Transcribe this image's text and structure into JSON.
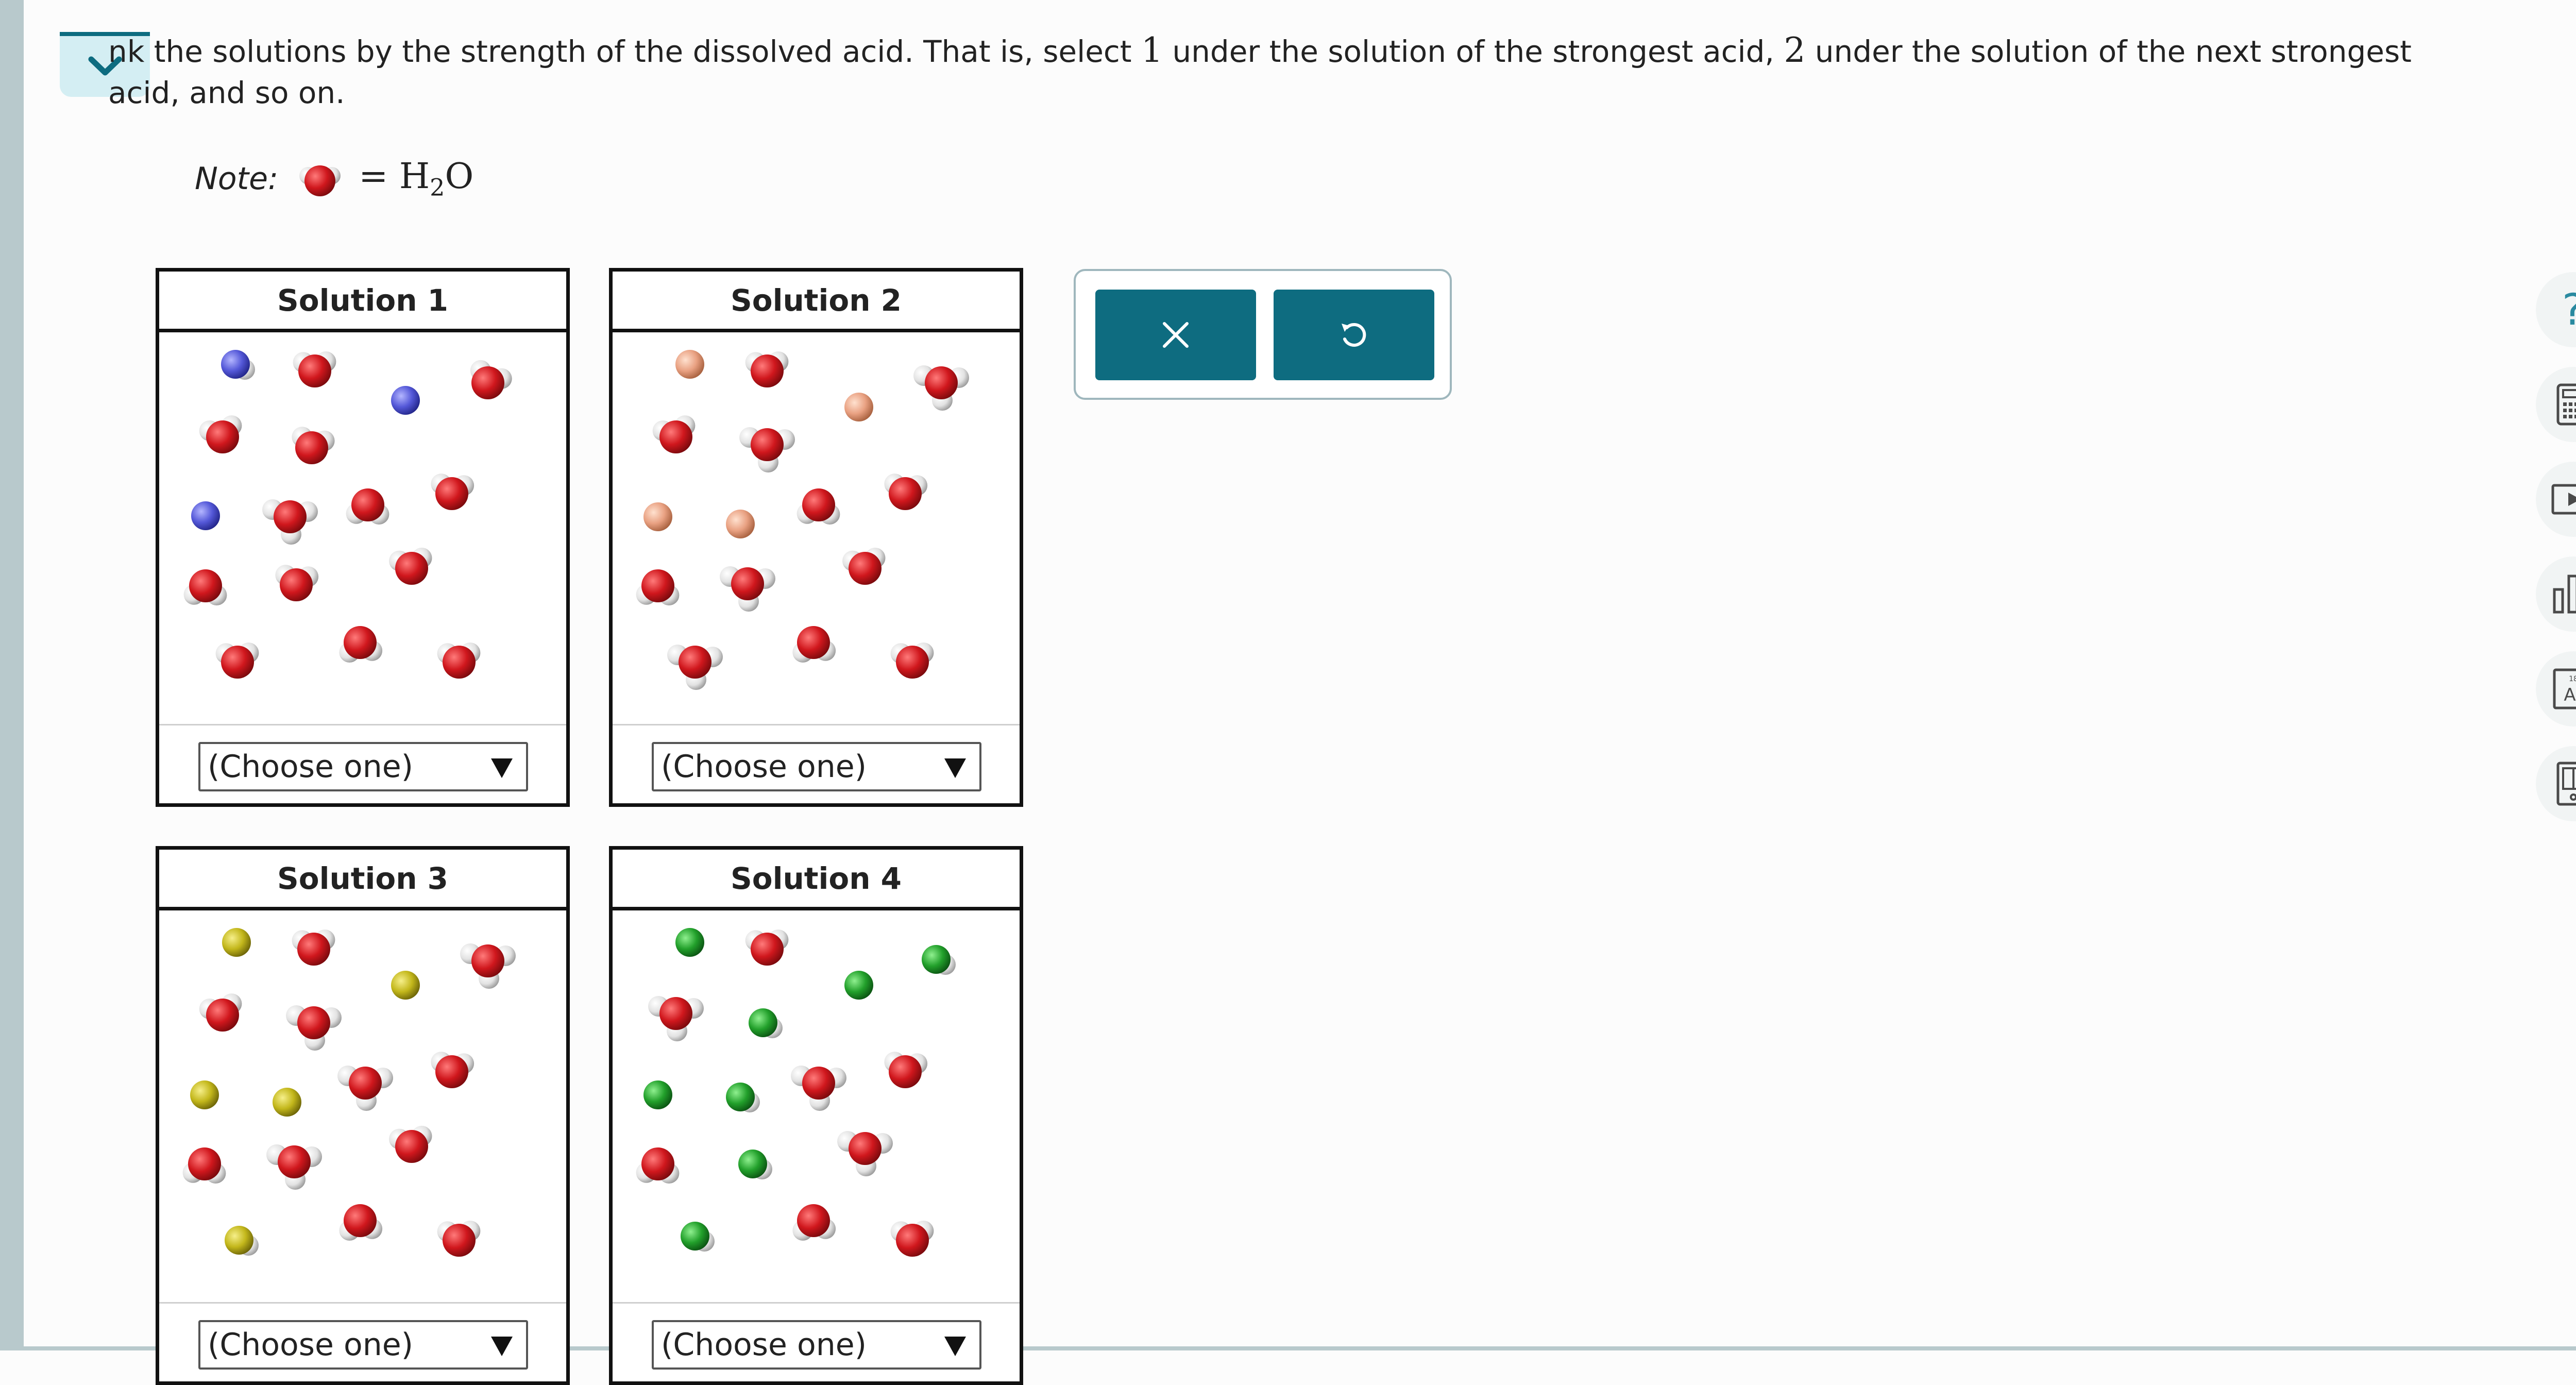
{
  "question": {
    "part1": "nk the solutions by the strength of the dissolved acid. That is, select ",
    "num1": "1",
    "part2": " under the solution of the strongest acid, ",
    "num2": "2",
    "part3": " under the solution of the next strongest",
    "line2": "acid, and so on."
  },
  "note": {
    "label": "Note:",
    "equals": "=",
    "formula_main": "H",
    "formula_sub": "2",
    "formula_end": "O"
  },
  "solutions": [
    {
      "title": "Solution 1",
      "select_value": "(Choose one)",
      "ion_color": "#5b5fe0"
    },
    {
      "title": "Solution 2",
      "select_value": "(Choose one)",
      "ion_color": "#eaa585"
    },
    {
      "title": "Solution 3",
      "select_value": "(Choose one)",
      "ion_color": "#c9bf1c"
    },
    {
      "title": "Solution 4",
      "select_value": "(Choose one)",
      "ion_color": "#25a32e"
    }
  ],
  "actions": {
    "clear_icon": "x-icon",
    "undo_icon": "undo-icon"
  },
  "sidebar_tools": [
    "help-icon",
    "calculator-icon",
    "video-icon",
    "data-chart-icon",
    "periodic-table-icon",
    "textbook-icon"
  ],
  "colors": {
    "accent": "#0e6c80",
    "water_oxygen": "#c81d25",
    "water_hydrogen": "#e6e6e6"
  }
}
